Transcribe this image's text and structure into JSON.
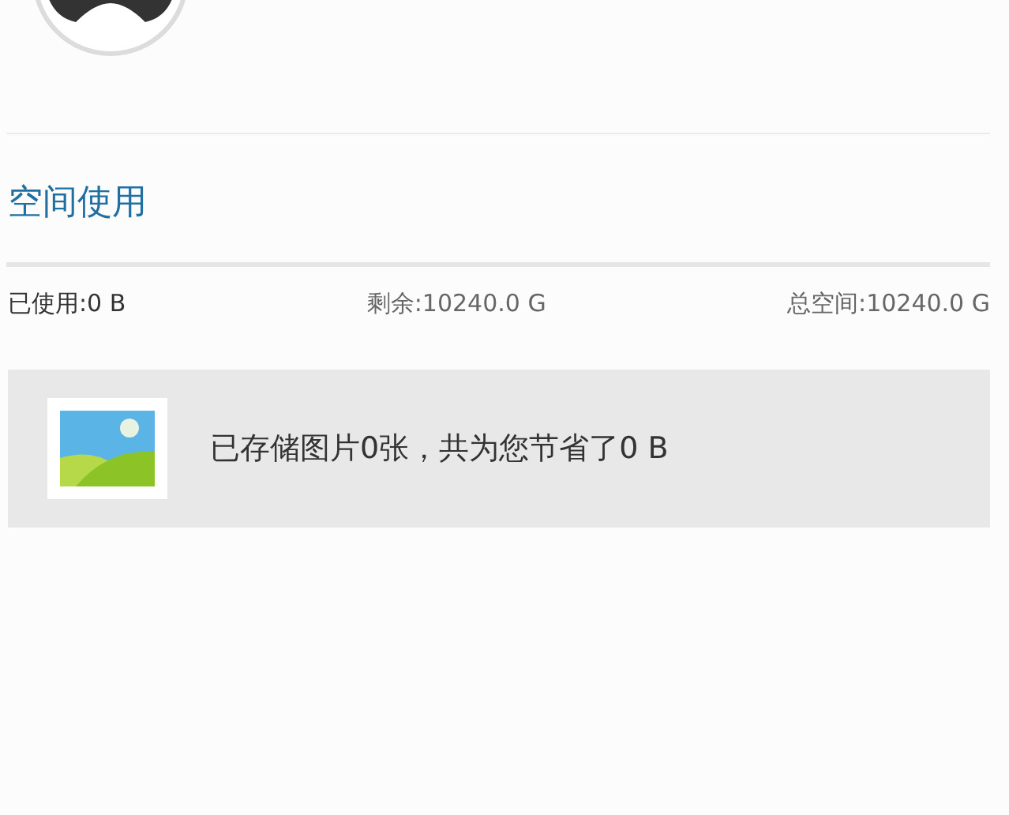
{
  "section": {
    "title": "空间使用"
  },
  "stats": [
    {
      "label": "已使用:0 B"
    },
    {
      "label": "剩余:10240.0 G"
    },
    {
      "label": "总空间:10240.0 G"
    }
  ],
  "photo_summary": {
    "text": "已存储图片0张，共为您节省了0 B"
  }
}
